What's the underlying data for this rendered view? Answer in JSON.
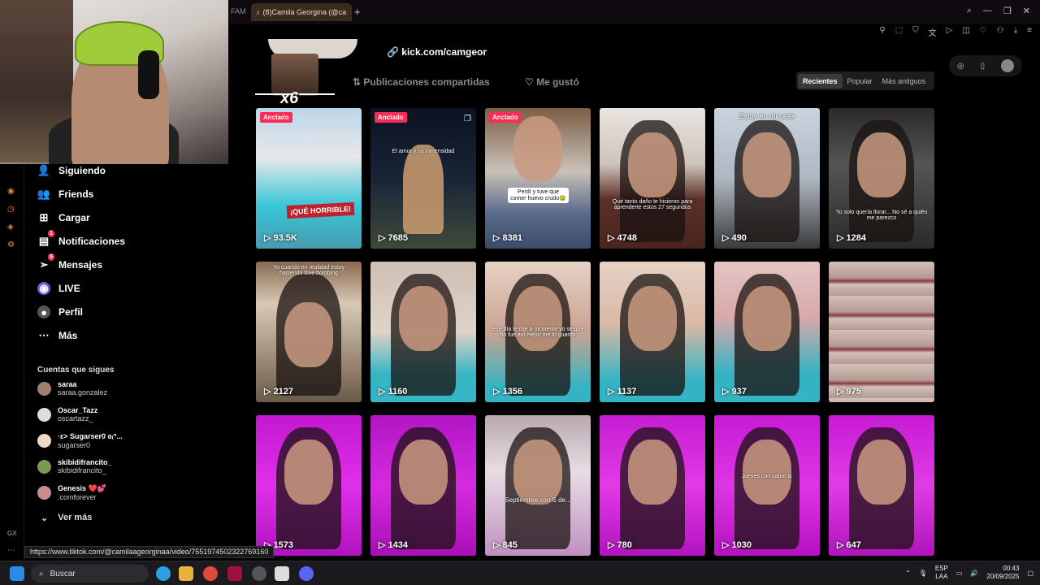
{
  "browser": {
    "prev_tab": "FAM",
    "tab_title": "(8)Camila Georgina (@ca",
    "new_tab": "+"
  },
  "sidebar": {
    "items": [
      {
        "label": "Siguiendo",
        "icon": "following-icon"
      },
      {
        "label": "Friends",
        "icon": "friends-icon"
      },
      {
        "label": "Cargar",
        "icon": "upload-icon"
      },
      {
        "label": "Notificaciones",
        "icon": "notifications-icon",
        "badge": "1"
      },
      {
        "label": "Mensajes",
        "icon": "messages-icon",
        "badge": "5"
      },
      {
        "label": "LIVE",
        "icon": "live-icon"
      },
      {
        "label": "Perfil",
        "icon": "profile-icon"
      },
      {
        "label": "Más",
        "icon": "more-icon"
      }
    ],
    "following_title": "Cuentas que sigues",
    "following": [
      {
        "name": "saraa",
        "handle": "saraa.gonzalez"
      },
      {
        "name": "Oscar_Tazz",
        "handle": "oscartazz_"
      },
      {
        "name": "·ε> Sugarser0 ɞ₍ᐢ...",
        "handle": "sugarser0"
      },
      {
        "name": "skibidifrancito_",
        "handle": "skibidifrancito_"
      },
      {
        "name": "Genesis ❤️💕",
        "handle": ".comforever"
      }
    ],
    "see_more": "Ver más"
  },
  "profile": {
    "link": "kick.com/camgeor",
    "avatar_overlay": "x6",
    "tabs": {
      "shared": "Publicaciones compartidas",
      "liked": "Me gustó"
    },
    "sort": [
      "Recientes",
      "Popular",
      "Más antiguos"
    ],
    "sort_selected": "Recientes"
  },
  "videos": [
    {
      "views": "93.5K",
      "pinned": "Anclado",
      "sticker": "¡QUÉ HORRIBLE!"
    },
    {
      "views": "7685",
      "pinned": "Anclado",
      "caption": "El amor y su inmensidad"
    },
    {
      "views": "8381",
      "pinned": "Anclado",
      "caption": "Perdí y tuve que comer huevo crudo🤢"
    },
    {
      "views": "4748",
      "caption": "Qué tanto daño te hicieron para aprenderte estos 27 segundos"
    },
    {
      "views": "490",
      "caption": "Estoy en mi peak"
    },
    {
      "views": "1284",
      "caption": "Yo solo quería llorar... No sé a quién me parezco"
    },
    {
      "views": "2127",
      "caption": "Yo cuando en realidad estoy haciendo love bombing"
    },
    {
      "views": "1160"
    },
    {
      "views": "1356",
      "caption": "Ese día le dije a mi mente yo sé que no fue así mejor me lo guardo"
    },
    {
      "views": "1137"
    },
    {
      "views": "937"
    },
    {
      "views": "975"
    },
    {
      "views": "1573"
    },
    {
      "views": "1434"
    },
    {
      "views": "845",
      "caption": "Septiembre con S de..."
    },
    {
      "views": "780"
    },
    {
      "views": "1030",
      "caption": "Jueves con sabor a:"
    },
    {
      "views": "647"
    }
  ],
  "status_url": "https://www.tiktok.com/@camilaageorginaa/video/7551974502322769160",
  "taskbar": {
    "search": "Buscar",
    "lang1": "ESP",
    "lang2": "LAA",
    "time": "00:43",
    "date": "20/09/2025"
  }
}
